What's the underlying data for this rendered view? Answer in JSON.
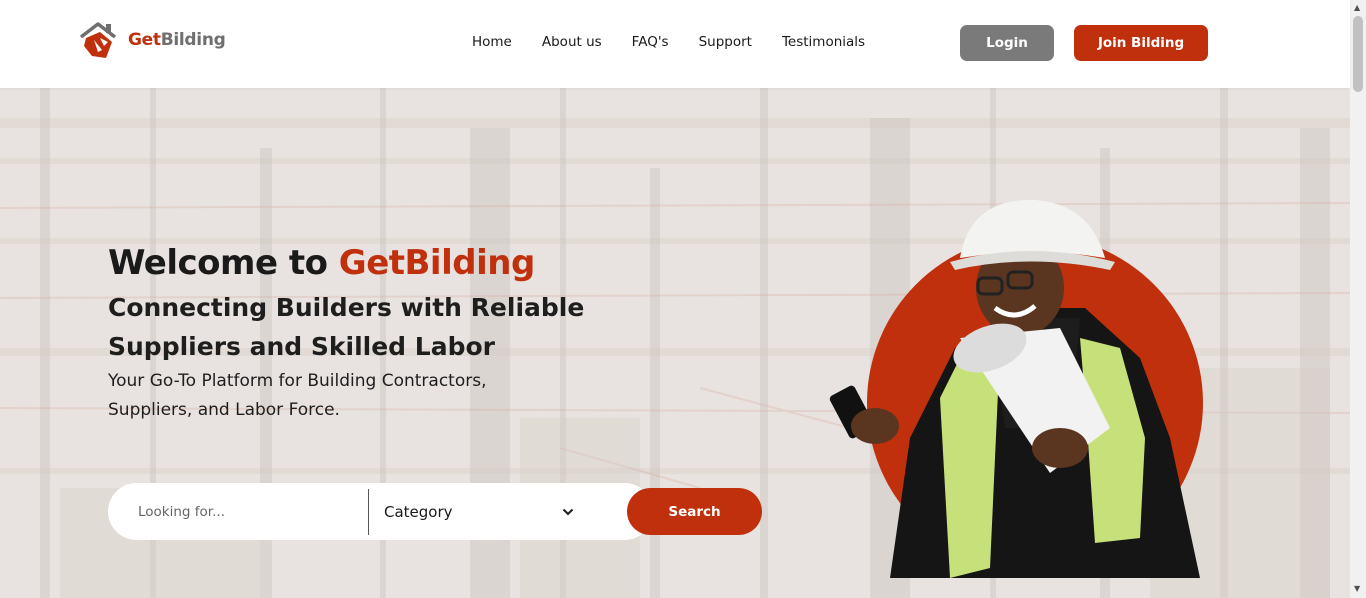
{
  "brand": {
    "name_accent": "Get",
    "name_rest": "Bilding",
    "accent_color": "#c0300c"
  },
  "nav": {
    "items": [
      {
        "label": "Home"
      },
      {
        "label": "About us"
      },
      {
        "label": "FAQ's"
      },
      {
        "label": "Support"
      },
      {
        "label": "Testimonials"
      }
    ]
  },
  "auth": {
    "login_label": "Login",
    "join_label": "Join Bilding"
  },
  "hero": {
    "title_prefix": "Welcome to ",
    "title_accent": "GetBilding",
    "subtitle": "Connecting Builders with Reliable Suppliers and Skilled Labor",
    "description": "Your Go-To Platform for Building Contractors, Suppliers, and Labor Force."
  },
  "search": {
    "placeholder": "Looking for...",
    "value": "",
    "category_label": "Category",
    "button_label": "Search"
  },
  "icons": {
    "logo": "house-logo-icon",
    "dropdown": "chevron-down-icon",
    "scroll_up": "scroll-up-arrow-icon",
    "scroll_down": "scroll-down-arrow-icon"
  }
}
